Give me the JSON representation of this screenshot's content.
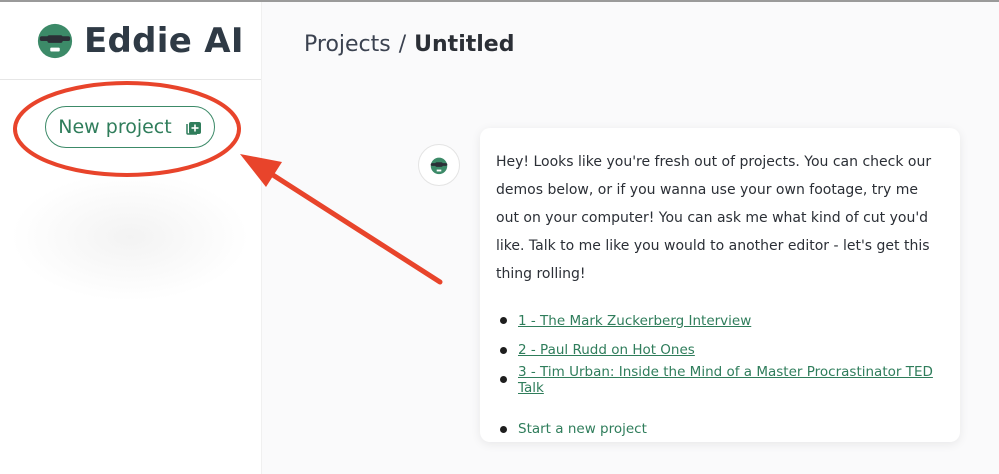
{
  "brand": {
    "name": "Eddie AI",
    "logo_icon": "eddie-logo-icon",
    "accent": "#3c8a68"
  },
  "sidebar": {
    "new_project_label": "New project",
    "new_project_icon": "plus-square-icon"
  },
  "breadcrumb": {
    "parent": "Projects",
    "separator": "/",
    "current": "Untitled"
  },
  "chat": {
    "avatar_icon": "eddie-bot-icon",
    "message": "Hey! Looks like you're fresh out of projects. You can check our demos below, or if you wanna use your own footage, try me out on your computer! You can ask me what kind of cut you'd like. Talk to me like you would to another editor - let's get this thing rolling!",
    "demos": [
      {
        "label": "1 - The Mark Zuckerberg Interview"
      },
      {
        "label": "2 - Paul Rudd on Hot Ones"
      },
      {
        "label": "3 - Tim Urban: Inside the Mind of a Master Procrastinator TED Talk"
      }
    ],
    "start_new_label": "Start a new project"
  },
  "annotation": {
    "color": "#e8442b"
  }
}
